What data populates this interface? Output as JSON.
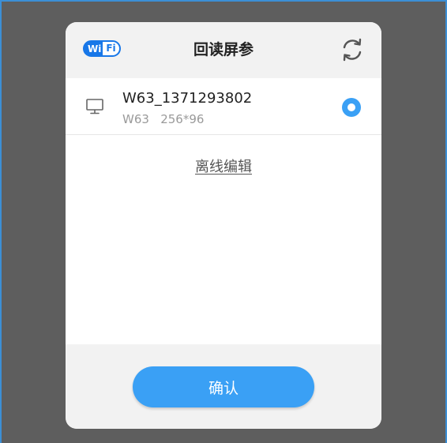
{
  "dialog": {
    "title": "回读屏参",
    "wifi_badge": {
      "left_text": "Wi",
      "right_text": "Fi",
      "color": "#1877e8"
    },
    "refresh_icon": "refresh-icon"
  },
  "device_list": [
    {
      "name": "W63_1371293802",
      "detail": "W63   256*96",
      "icon": "monitor-icon",
      "selected": true
    }
  ],
  "offline_edit_link": "离线编辑",
  "confirm_button": "确认",
  "colors": {
    "accent": "#3aa0f5",
    "overlay": "#5e5e5e",
    "dialog_bg": "#f2f2f2"
  }
}
